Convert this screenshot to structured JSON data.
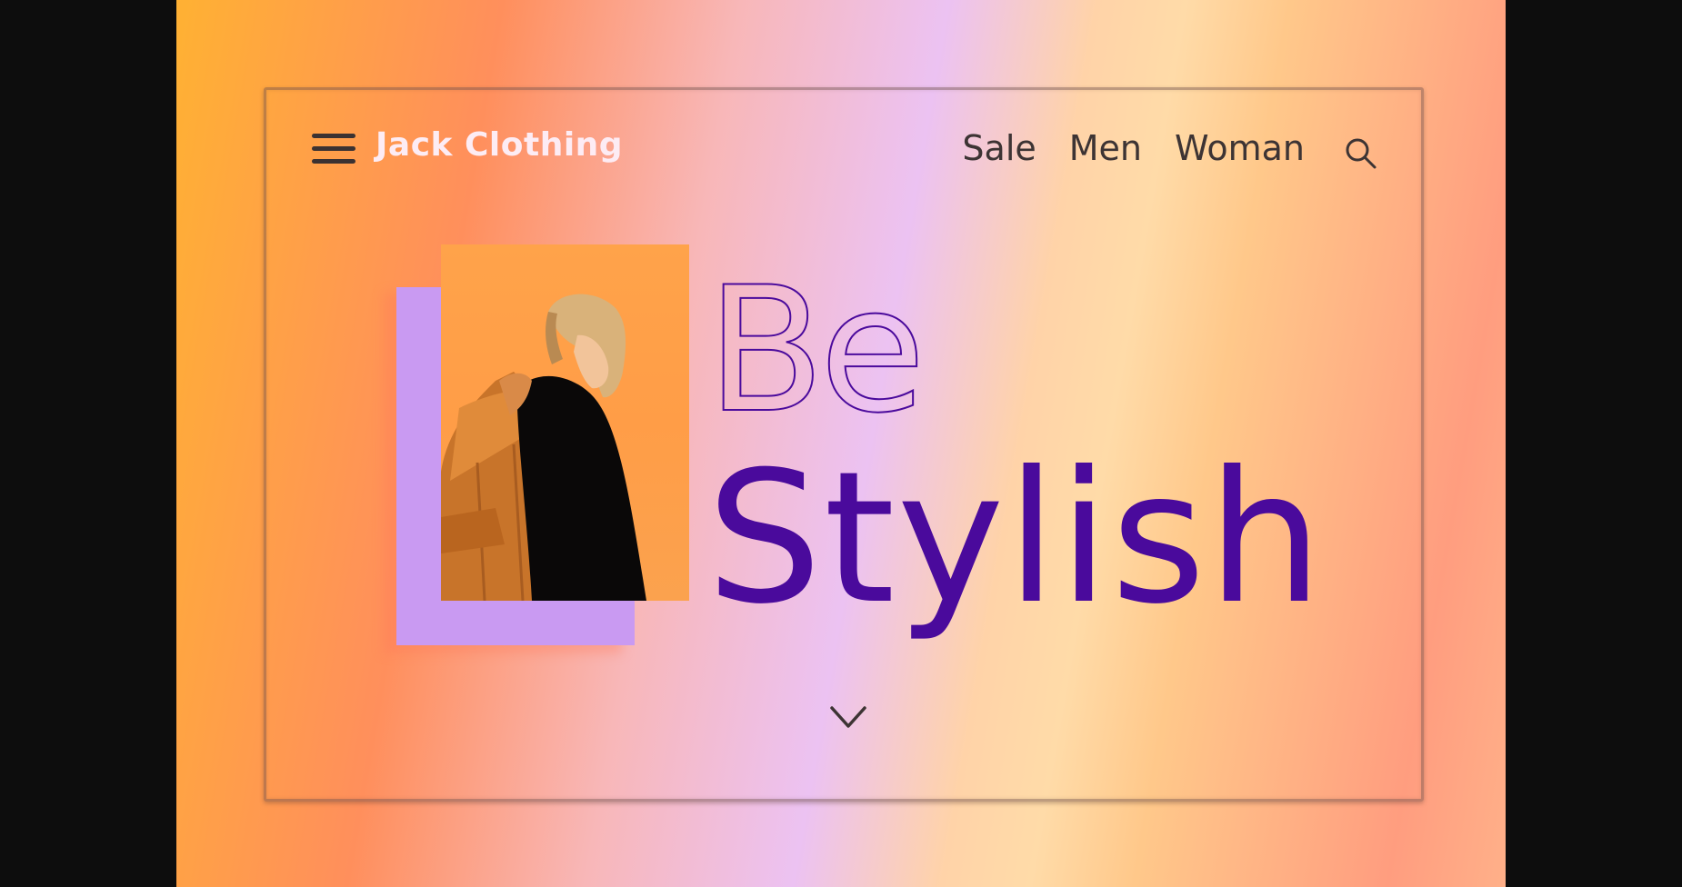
{
  "brand": {
    "name": "Jack Clothing"
  },
  "nav": {
    "items": [
      {
        "label": "Sale"
      },
      {
        "label": "Men"
      },
      {
        "label": "Woman"
      }
    ]
  },
  "hero": {
    "headline_line1": "Be",
    "headline_line2": "Stylish"
  },
  "icons": {
    "menu": "hamburger-menu-icon",
    "search": "search-icon",
    "scroll": "chevron-down-icon"
  },
  "colors": {
    "headline": "#4a0a9c",
    "nav_text": "#3d3434",
    "brand_text": "#fdecf4",
    "photo_accent": "#c99af2"
  }
}
